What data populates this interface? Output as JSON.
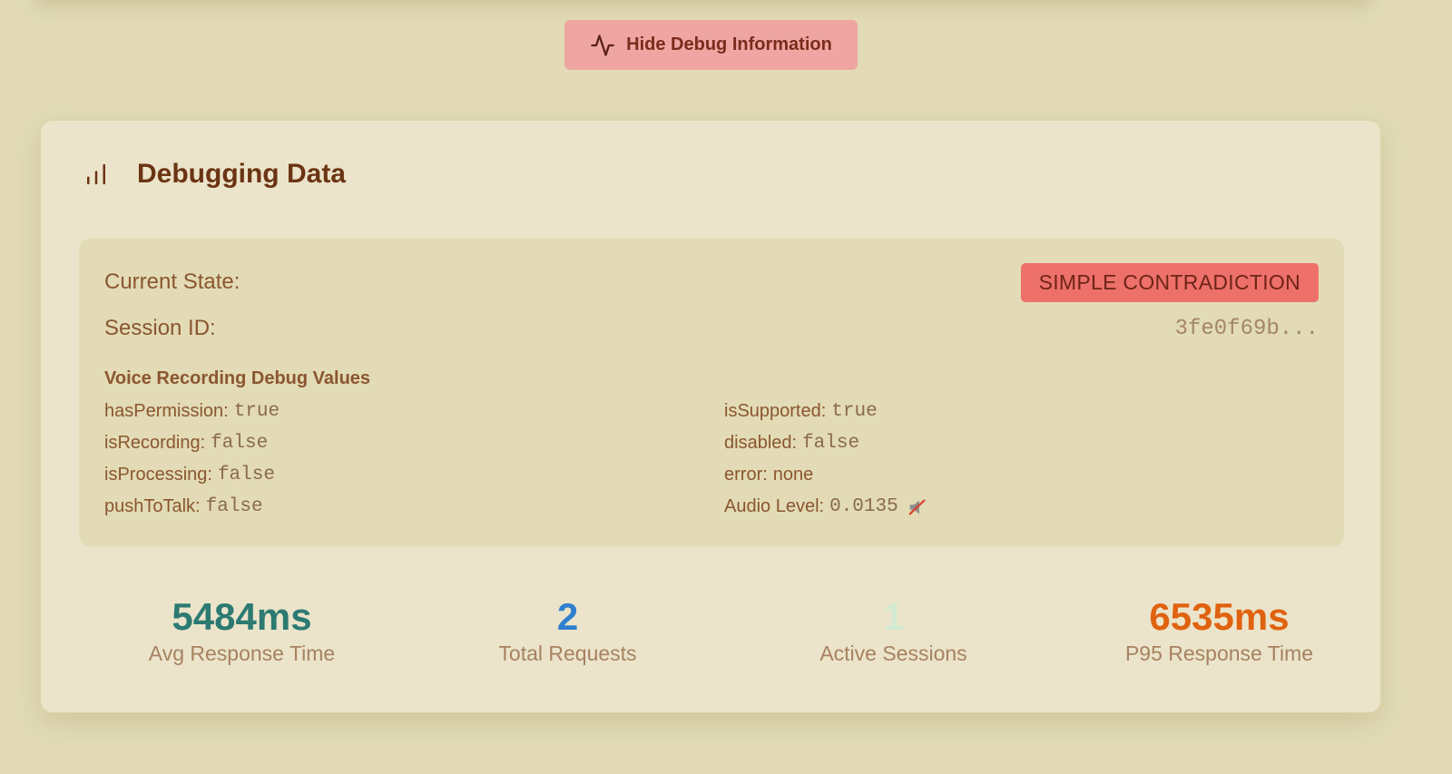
{
  "toolbar": {
    "toggle_label": "Hide Debug Information",
    "toggle_icon": "activity-icon"
  },
  "card": {
    "title": "Debugging Data",
    "title_icon": "bar-chart-icon",
    "current_state": {
      "label": "Current State:",
      "value": "SIMPLE CONTRADICTION",
      "color": "#ed706a"
    },
    "session": {
      "label": "Session ID:",
      "value": "3fe0f69b..."
    },
    "voice": {
      "title": "Voice Recording Debug Values",
      "left": [
        {
          "key": "hasPermission:",
          "value": "true"
        },
        {
          "key": "isRecording:",
          "value": "false"
        },
        {
          "key": "isProcessing:",
          "value": "false"
        },
        {
          "key": "pushToTalk:",
          "value": "false"
        }
      ],
      "right": [
        {
          "key": "isSupported:",
          "value": "true"
        },
        {
          "key": "disabled:",
          "value": "false"
        },
        {
          "key": "error:",
          "value": "none"
        },
        {
          "key": "Audio Level:",
          "value": "0.0135",
          "icon": "muted-speaker-icon"
        }
      ]
    }
  },
  "stats": [
    {
      "value": "5484ms",
      "label": "Avg Response Time",
      "color": "#2c7a72"
    },
    {
      "value": "2",
      "label": "Total Requests",
      "color": "#2f7fcf"
    },
    {
      "value": "1",
      "label": "Active Sessions",
      "color": "#d3ead3"
    },
    {
      "value": "6535ms",
      "label": "P95 Response Time",
      "color": "#e0620f"
    }
  ]
}
